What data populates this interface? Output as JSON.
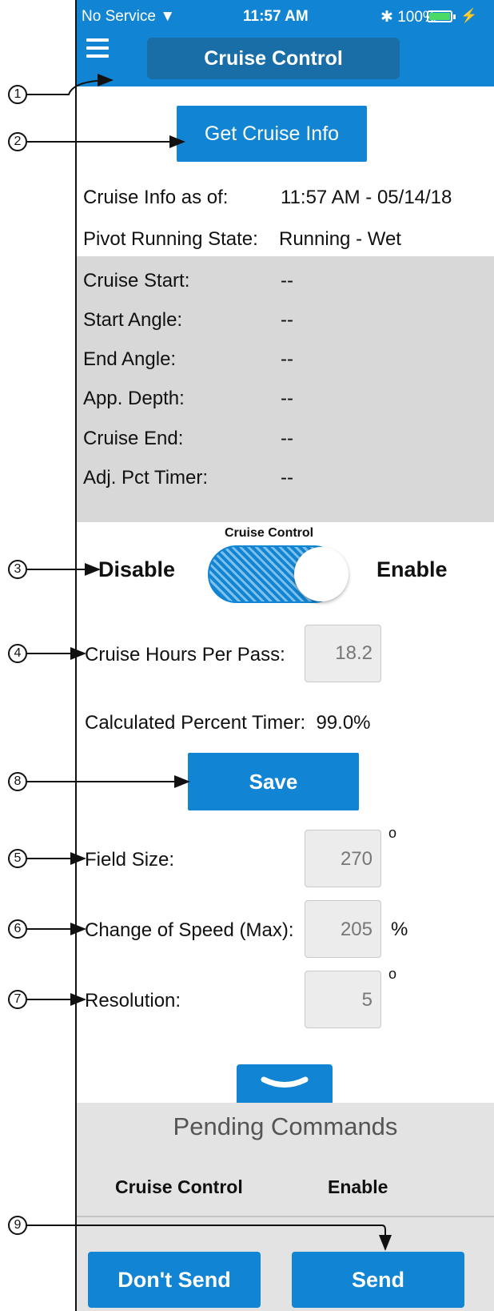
{
  "status_bar": {
    "carrier": "No Service",
    "time": "11:57 AM",
    "battery": "100%"
  },
  "nav": {
    "title": "Cruise Control"
  },
  "get_info_button": "Get Cruise Info",
  "cruise_info": {
    "label": "Cruise Info as of:",
    "value": "11:57 AM - 05/14/18"
  },
  "pivot_state": {
    "label": "Pivot Running State:",
    "value": "Running - Wet"
  },
  "details": [
    {
      "label": "Cruise Start:",
      "value": "--"
    },
    {
      "label": "Start Angle:",
      "value": "--"
    },
    {
      "label": "End Angle:",
      "value": "--"
    },
    {
      "label": "App. Depth:",
      "value": "--"
    },
    {
      "label": "Cruise End:",
      "value": "--"
    },
    {
      "label": "Adj. Pct Timer:",
      "value": "--"
    }
  ],
  "toggle": {
    "title": "Cruise Control",
    "off_label": "Disable",
    "on_label": "Enable",
    "state": "on"
  },
  "hours_per_pass": {
    "label": "Cruise Hours Per Pass:",
    "value": "18.2"
  },
  "percent_timer": {
    "text": "Calculated Percent Timer:  99.0%"
  },
  "save_button": "Save",
  "field_size": {
    "label": "Field Size:",
    "value": "270",
    "unit": "o"
  },
  "change_speed": {
    "label": "Change of Speed (Max):",
    "value": "205",
    "unit": "%"
  },
  "resolution": {
    "label": "Resolution:",
    "value": "5",
    "unit": "o"
  },
  "pending": {
    "title": "Pending Commands",
    "command": "Cruise Control",
    "command_value": "Enable"
  },
  "dont_send_button": "Don't Send",
  "send_button": "Send",
  "callouts": [
    "1",
    "2",
    "3",
    "4",
    "8",
    "5",
    "6",
    "7",
    "9"
  ],
  "colors": {
    "primary": "#1185d3",
    "nav_title_bg": "#1a6ea7",
    "panel_grey": "#d8d8d8"
  },
  "icons": [
    "wifi-icon",
    "bluetooth-icon",
    "battery-icon",
    "menu-icon",
    "chevron-down-icon"
  ]
}
